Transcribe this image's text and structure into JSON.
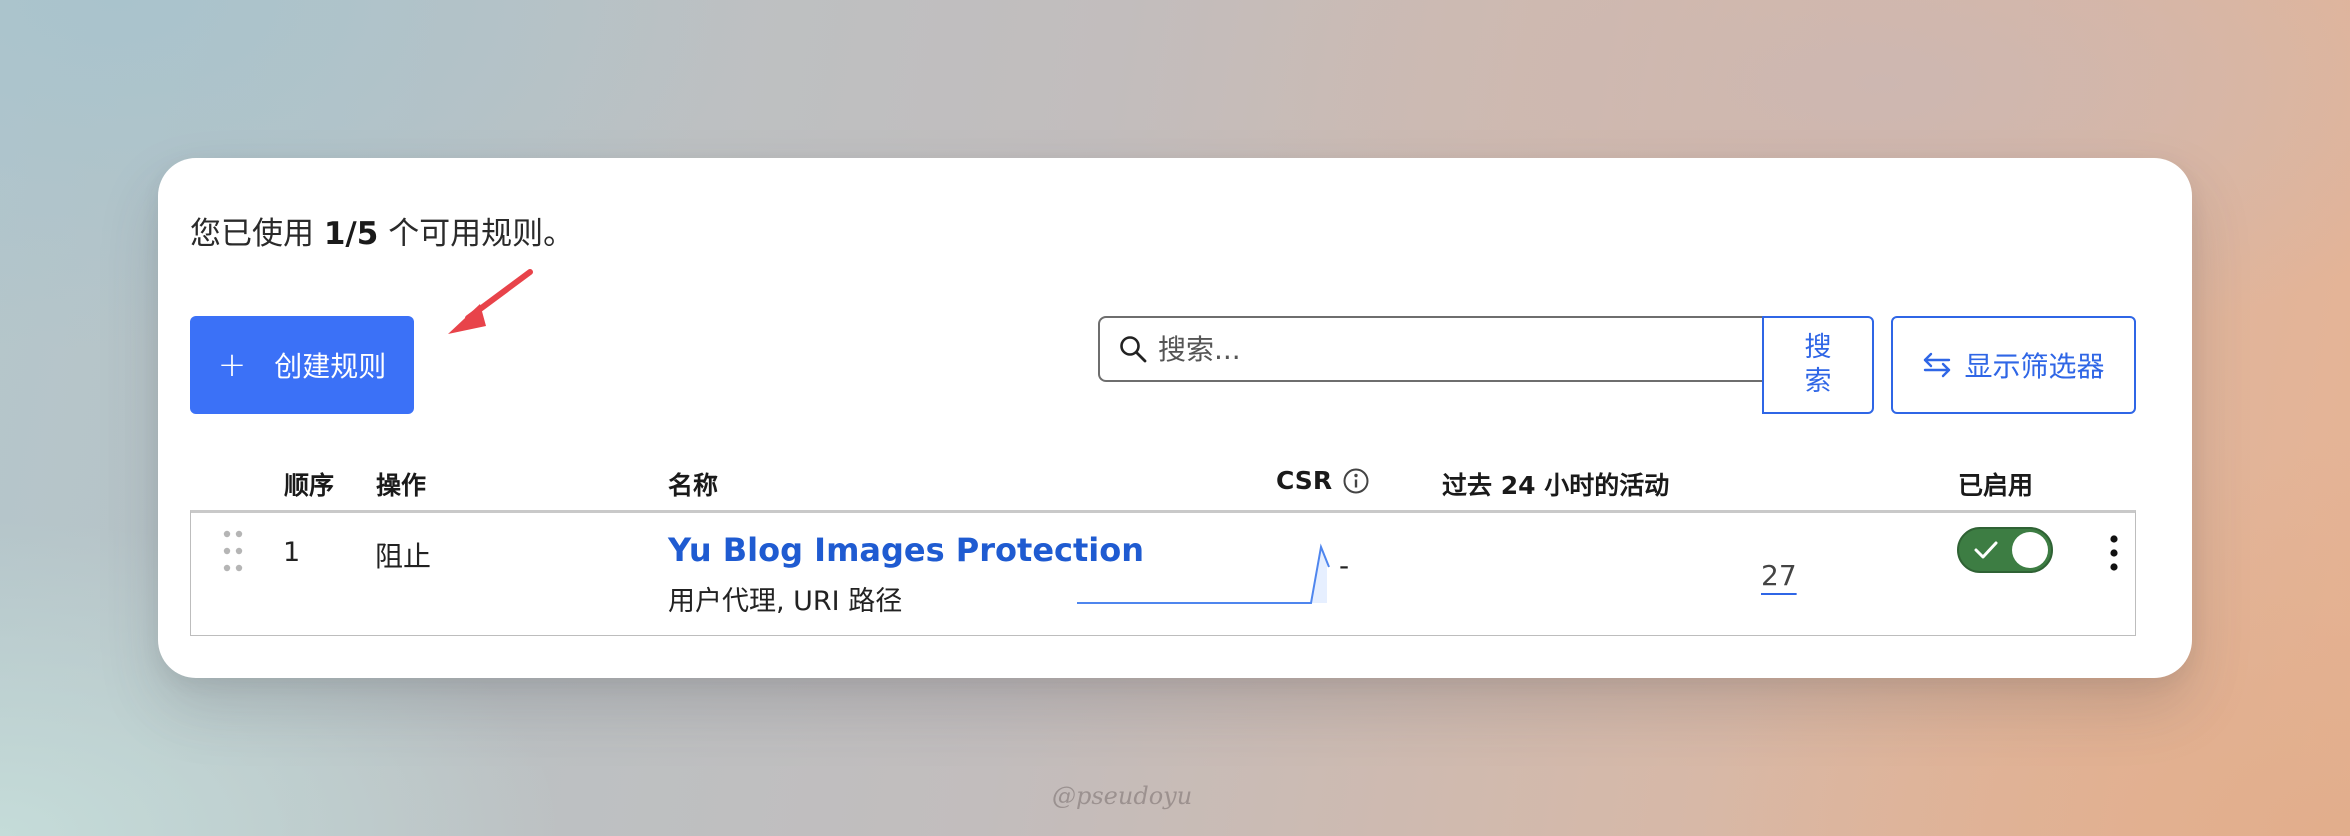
{
  "usage": {
    "prefix": "您已使用",
    "count": "1/5",
    "suffix": "个可用规则。"
  },
  "toolbar": {
    "create_label": "创建规则",
    "search_placeholder": "搜索...",
    "search_button": "搜索",
    "filter_button": "显示筛选器"
  },
  "table": {
    "headers": {
      "order": "顺序",
      "action": "操作",
      "name": "名称",
      "csr": "CSR",
      "activity": "过去 24 小时的活动",
      "enabled": "已启用"
    },
    "rows": [
      {
        "order": "1",
        "action": "阻止",
        "name": "Yu Blog Images Protection",
        "description": "用户代理, URI 路径",
        "csr": "-",
        "activity_count": "27",
        "enabled": true
      }
    ]
  },
  "icons": {
    "create": "plus-icon",
    "search": "search-icon",
    "filter": "swap-arrows-icon",
    "csr_info": "info-icon",
    "drag": "drag-handle-icon",
    "toggle_check": "check-icon",
    "more": "kebab-menu-icon",
    "annotation": "arrow-icon"
  },
  "colors": {
    "primary": "#3b71f7",
    "link": "#1f5bd1",
    "toggle_on": "#3d7d43",
    "annotation_arrow": "#e8434a"
  },
  "watermark": "@pseudoyu"
}
